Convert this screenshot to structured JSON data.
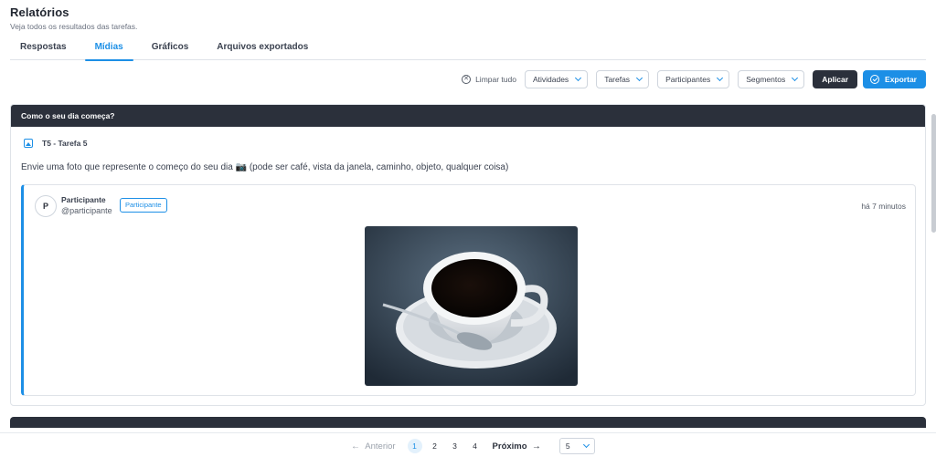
{
  "header": {
    "title": "Relatórios",
    "subtitle": "Veja todos os resultados das tarefas."
  },
  "tabs": [
    {
      "label": "Respostas",
      "active": false
    },
    {
      "label": "Mídias",
      "active": true
    },
    {
      "label": "Gráficos",
      "active": false
    },
    {
      "label": "Arquivos exportados",
      "active": false
    }
  ],
  "filters": {
    "clear_label": "Limpar tudo",
    "dropdowns": [
      "Atividades",
      "Tarefas",
      "Participantes",
      "Segmentos"
    ],
    "apply_label": "Aplicar",
    "export_label": "Exportar"
  },
  "card": {
    "question_title": "Como o seu dia começa?",
    "task_label": "T5 - Tarefa 5",
    "prompt": "Envie uma foto que represente o começo do seu dia 📷 (pode ser café, vista da janela, caminho, objeto, qualquer coisa)",
    "response": {
      "avatar_initial": "P",
      "name": "Participante",
      "handle": "@participante",
      "badge": "Participante",
      "time": "há 7 minutos",
      "image_subject": "coffee-cup-photo"
    }
  },
  "pagination": {
    "prev_label": "Anterior",
    "next_label": "Próximo",
    "pages": [
      "1",
      "2",
      "3",
      "4"
    ],
    "current_page": "1",
    "page_size": "5"
  },
  "colors": {
    "accent": "#1c8fe6",
    "dark": "#2b303b"
  }
}
